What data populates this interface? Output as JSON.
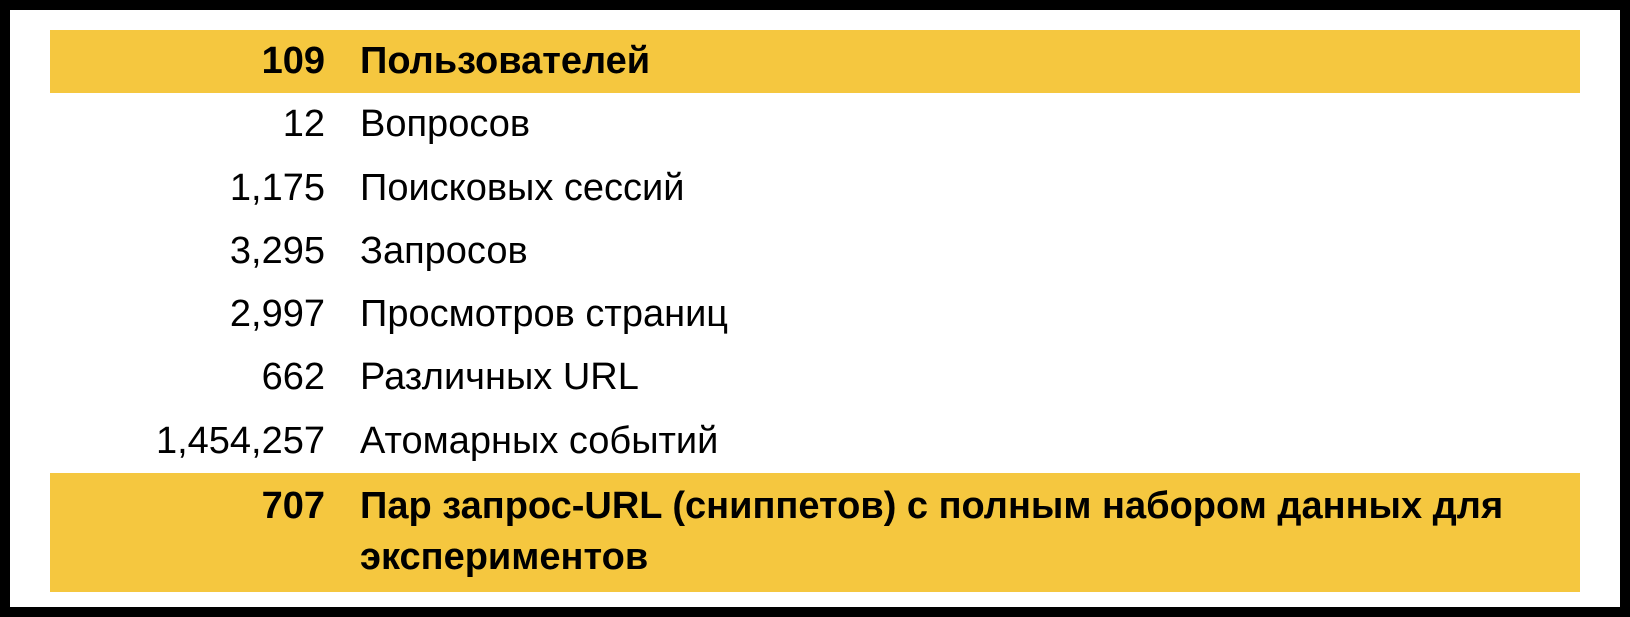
{
  "chart_data": {
    "type": "table",
    "rows": [
      {
        "value": "109",
        "label": "Пользователей",
        "highlighted": true
      },
      {
        "value": "12",
        "label": "Вопросов",
        "highlighted": false
      },
      {
        "value": "1,175",
        "label": "Поисковых сессий",
        "highlighted": false
      },
      {
        "value": "3,295",
        "label": "Запросов",
        "highlighted": false
      },
      {
        "value": "2,997",
        "label": "Просмотров страниц",
        "highlighted": false
      },
      {
        "value": "662",
        "label": "Различных URL",
        "highlighted": false
      },
      {
        "value": "1,454,257",
        "label": "Атомарных событий",
        "highlighted": false
      },
      {
        "value": "707",
        "label": "Пар запрос-URL (сниппетов) с полным набором данных для экспериментов",
        "highlighted": true
      }
    ]
  },
  "colors": {
    "highlight": "#f5c73f",
    "background": "#ffffff",
    "border": "#000000",
    "text": "#000000"
  }
}
